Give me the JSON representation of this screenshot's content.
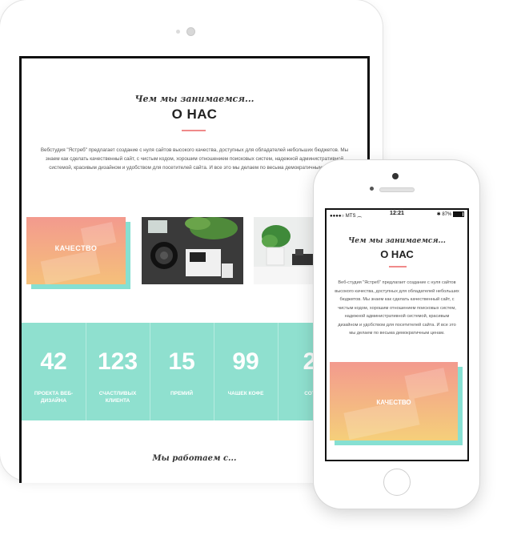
{
  "tablet": {
    "subtitle": "Чем мы занимаемся...",
    "title": "О НАС",
    "paragraph": "Вебстудия \"Ястреб\" предлагает создание с нуля сайтов высокого качества, доступных для обладателей небольших бюджетов. Мы знаем как сделать качественный сайт, с чистым кодом, хорошим отношением поисковых систем, надежной административной системой, красивым дизайном и удобством для посетителей сайта. И все это мы делаем по весьма демократичным ценам.",
    "card_label": "КАЧЕСТВО",
    "stats": [
      {
        "num": "42",
        "caption": "ПРОЕКТА ВЕБ-ДИЗАЙНА"
      },
      {
        "num": "123",
        "caption": "СЧАСТЛИВЫХ КЛИЕНТА"
      },
      {
        "num": "15",
        "caption": "ПРЕМИЙ"
      },
      {
        "num": "99",
        "caption": "ЧАШЕК КОФЕ"
      },
      {
        "num": "2",
        "caption": "СОТ"
      }
    ],
    "footer_subtitle": "Мы работаем с..."
  },
  "phone": {
    "status": {
      "carrier": "MTS",
      "time": "12:21",
      "battery": "87%"
    },
    "subtitle": "Чем мы занимаемся...",
    "title": "О НАС",
    "paragraph": "Веб-студия \"Ястреб\" предлагает создание с нуля сайтов высокого качества, доступных для обладателей небольших бюджетов. Мы знаем как сделать качественный сайт, с чистым кодом, хорошим отношением поисковых систем, надежной административной системой, красивым дизайном и удобством для посетителей сайта. И все это мы делаем по весьма демократичным ценам.",
    "card_label": "КАЧЕСТВО"
  },
  "colors": {
    "accent_teal": "#8fe0cf",
    "accent_coral": "#f39a8e",
    "accent_gold": "#f5c07a",
    "underline": "#f08a8a"
  }
}
